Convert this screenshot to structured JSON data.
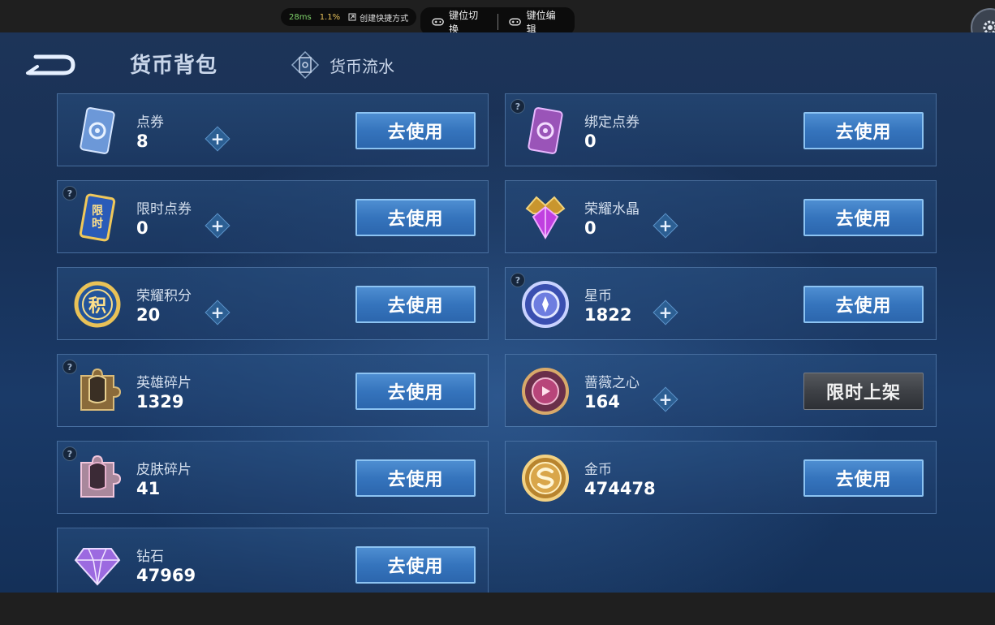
{
  "toolbar": {
    "latency": "28ms",
    "cpu": "1.1%",
    "shortcut": "创建快捷方式",
    "key_switch": "键位切换",
    "key_edit": "键位编辑"
  },
  "header": {
    "title": "货币背包",
    "flow_tab": "货币流水"
  },
  "cards": [
    {
      "name": "点券",
      "amount": "8",
      "button": "去使用"
    },
    {
      "name": "绑定点券",
      "amount": "0",
      "button": "去使用"
    },
    {
      "name": "限时点券",
      "amount": "0",
      "button": "去使用"
    },
    {
      "name": "荣耀水晶",
      "amount": "0",
      "button": "去使用"
    },
    {
      "name": "荣耀积分",
      "amount": "20",
      "button": "去使用"
    },
    {
      "name": "星币",
      "amount": "1822",
      "button": "去使用"
    },
    {
      "name": "英雄碎片",
      "amount": "1329",
      "button": "去使用"
    },
    {
      "name": "蔷薇之心",
      "amount": "164",
      "button": "限时上架"
    },
    {
      "name": "皮肤碎片",
      "amount": "41",
      "button": "去使用"
    },
    {
      "name": "金币",
      "amount": "474478",
      "button": "去使用"
    },
    {
      "name": "钻石",
      "amount": "47969",
      "button": "去使用"
    }
  ],
  "icons": {
    "limited_coupon_text": "限时",
    "points_text": "积",
    "help_mark": "?"
  }
}
